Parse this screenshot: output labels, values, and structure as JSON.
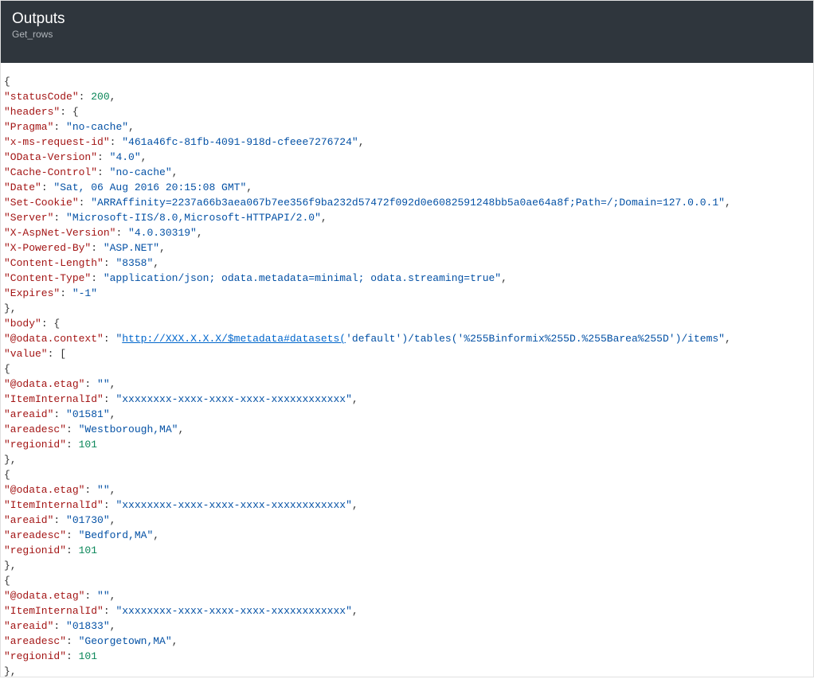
{
  "header": {
    "title": "Outputs",
    "subtitle": "Get_rows"
  },
  "json": {
    "statusCode": 200,
    "headers": {
      "Pragma": "no-cache",
      "x-ms-request-id": "461a46fc-81fb-4091-918d-cfeee7276724",
      "OData-Version": "4.0",
      "Cache-Control": "no-cache",
      "Date": "Sat, 06 Aug 2016 20:15:08 GMT",
      "Set-Cookie": "ARRAffinity=2237a66b3aea067b7ee356f9ba232d57472f092d0e6082591248bb5a0ae64a8f;Path=/;Domain=127.0.0.1",
      "Server": "Microsoft-IIS/8.0,Microsoft-HTTPAPI/2.0",
      "X-AspNet-Version": "4.0.30319",
      "X-Powered-By": "ASP.NET",
      "Content-Length": "8358",
      "Content-Type": "application/json; odata.metadata=minimal; odata.streaming=true",
      "Expires": "-1"
    },
    "body": {
      "@odata.context_prefix": "http://XXX.X.X.X/$metadata#datasets(",
      "@odata.context_suffix": "'default')/tables('%255Binformix%255D.%255Barea%255D')/items",
      "value": [
        {
          "@odata.etag": "",
          "ItemInternalId": "xxxxxxxx-xxxx-xxxx-xxxx-xxxxxxxxxxxx",
          "areaid": "01581",
          "areadesc": "Westborough,MA",
          "regionid": 101
        },
        {
          "@odata.etag": "",
          "ItemInternalId": "xxxxxxxx-xxxx-xxxx-xxxx-xxxxxxxxxxxx",
          "areaid": "01730",
          "areadesc": "Bedford,MA",
          "regionid": 101
        },
        {
          "@odata.etag": "",
          "ItemInternalId": "xxxxxxxx-xxxx-xxxx-xxxx-xxxxxxxxxxxx",
          "areaid": "01833",
          "areadesc": "Georgetown,MA",
          "regionid": 101
        }
      ]
    }
  },
  "indent": "    "
}
